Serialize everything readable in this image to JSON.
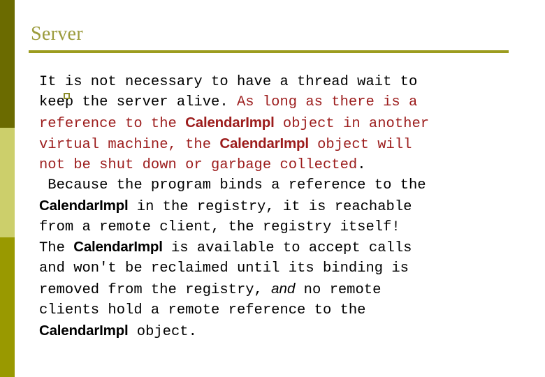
{
  "slide": {
    "title": "Server",
    "background_color": "#ffffff",
    "accent_color": "#99991f",
    "title_color": "#9c9c3d",
    "rule_color": "#9c9c1f",
    "body_black": "#000000",
    "body_red": "#9c1c1c",
    "sidebar": {
      "band_top_color": "#6b6b00",
      "band_mid_color": "#cccf6b",
      "band_bottom_color": "#999900"
    },
    "bullet_marker_color": "#8c8c2a"
  },
  "body": {
    "lines": [
      {
        "id": "l1",
        "runs": [
          {
            "text": "It is not necessary to have a thread wait to",
            "style": "mono-black"
          }
        ]
      },
      {
        "id": "l2",
        "runs": [
          {
            "text": "keep the server alive. ",
            "style": "mono-black"
          },
          {
            "text": "As long as there is a",
            "style": "mono-red"
          }
        ]
      },
      {
        "id": "l3",
        "runs": [
          {
            "text": "reference to the ",
            "style": "mono-red"
          },
          {
            "text": "CalendarImpl",
            "style": "sans-bold-red"
          },
          {
            "text": " object in another",
            "style": "mono-red"
          }
        ]
      },
      {
        "id": "l4",
        "runs": [
          {
            "text": "virtual machine, the ",
            "style": "mono-red"
          },
          {
            "text": "CalendarImpl",
            "style": "sans-bold-red"
          },
          {
            "text": " object will",
            "style": "mono-red"
          }
        ]
      },
      {
        "id": "l5",
        "runs": [
          {
            "text": "not be shut down or garbage collected",
            "style": "mono-red"
          },
          {
            "text": ".",
            "style": "mono-black"
          }
        ]
      },
      {
        "id": "l6",
        "runs": [
          {
            "text": " Because the program binds a reference to the",
            "style": "mono-black"
          }
        ]
      },
      {
        "id": "l7",
        "runs": [
          {
            "text": "CalendarImpl",
            "style": "sans-bold-black"
          },
          {
            "text": " in the registry, it is reachable",
            "style": "mono-black"
          }
        ]
      },
      {
        "id": "l8",
        "runs": [
          {
            "text": "from a remote client, the registry itself!",
            "style": "mono-black"
          }
        ]
      },
      {
        "id": "l9",
        "runs": [
          {
            "text": "The ",
            "style": "mono-black"
          },
          {
            "text": "CalendarImpl",
            "style": "sans-bold-black"
          },
          {
            "text": " is available to accept calls",
            "style": "mono-black"
          }
        ]
      },
      {
        "id": "l10",
        "runs": [
          {
            "text": "and won't be reclaimed until its binding is",
            "style": "mono-black"
          }
        ]
      },
      {
        "id": "l11",
        "runs": [
          {
            "text": "removed from the registry, ",
            "style": "mono-black"
          },
          {
            "text": "and",
            "style": "sans-italic-black"
          },
          {
            "text": " no remote",
            "style": "mono-black"
          }
        ]
      },
      {
        "id": "l12",
        "runs": [
          {
            "text": "clients hold a remote reference to the",
            "style": "mono-black"
          }
        ]
      },
      {
        "id": "l13",
        "runs": [
          {
            "text": "CalendarImpl",
            "style": "sans-bold-black"
          },
          {
            "text": " object.",
            "style": "mono-black"
          }
        ]
      }
    ]
  }
}
